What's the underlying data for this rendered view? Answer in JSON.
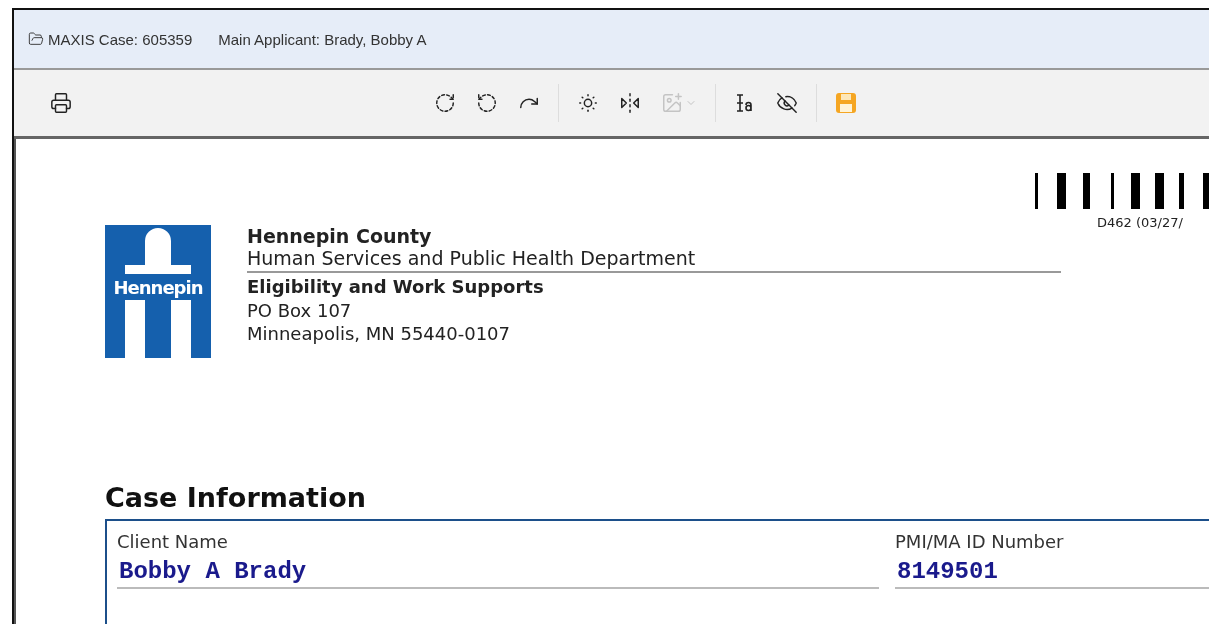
{
  "header": {
    "case": "MAXIS Case: 605359",
    "applicant": "Main Applicant: Brady, Bobby A"
  },
  "toolbar": {
    "groups": [
      [
        {
          "kind": "print",
          "disabled": false
        }
      ],
      [
        {
          "kind": "rotate-cw",
          "disabled": false
        },
        {
          "kind": "rotate-ccw",
          "disabled": false
        },
        {
          "kind": "rotate-180",
          "disabled": false
        }
      ],
      [
        {
          "kind": "brightness",
          "disabled": false
        },
        {
          "kind": "flip",
          "disabled": false
        },
        {
          "kind": "image",
          "disabled": true
        }
      ],
      [
        {
          "kind": "text",
          "disabled": false
        },
        {
          "kind": "hide",
          "disabled": false
        }
      ],
      [
        {
          "kind": "save",
          "disabled": false
        }
      ]
    ]
  },
  "document": {
    "logo_text": "Hennepin",
    "org": "Hennepin County",
    "department": "Human Services and Public Health Department",
    "unit": "Eligibility and Work Supports",
    "address": [
      "PO Box 107",
      "Minneapolis, MN 55440-0107"
    ],
    "form_code": "D462 (03/27/",
    "section_title": "Case Information",
    "fields": [
      {
        "label": "Client Name",
        "value": "Bobby A Brady"
      },
      {
        "label": "PMI/MA ID Number",
        "value": "8149501"
      }
    ]
  }
}
